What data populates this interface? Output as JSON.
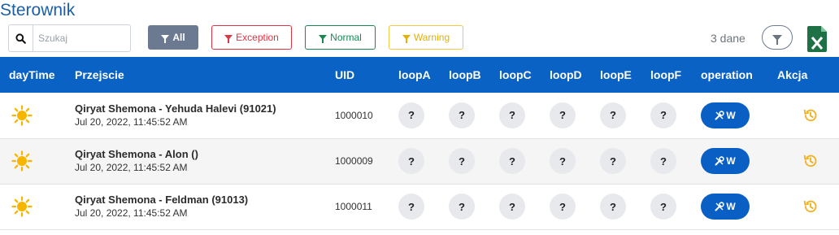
{
  "page": {
    "title": "Sterownik"
  },
  "search": {
    "placeholder": "Szukaj",
    "value": ""
  },
  "filters": {
    "all": "All",
    "exception": "Exception",
    "normal": "Normal",
    "warning": "Warning"
  },
  "count": "3 dane",
  "colors": {
    "header_bg": "#0a63c4",
    "accent": "#0a5fc4",
    "exception": "#dc3545",
    "normal": "#198754",
    "warning": "#e5b000",
    "sun": "#f7b500"
  },
  "table": {
    "headers": [
      "dayTime",
      "Przejscie",
      "UID",
      "loopA",
      "loopB",
      "loopC",
      "loopD",
      "loopE",
      "loopF",
      "operation",
      "Akcja"
    ],
    "rows": [
      {
        "daytime_icon": "sun-icon",
        "name": "Qiryat Shemona - Yehuda Halevi (91021)",
        "date": "Jul 20, 2022, 11:45:52 AM",
        "uid": "1000010",
        "loops": [
          "?",
          "?",
          "?",
          "?",
          "?",
          "?"
        ],
        "operation": "W",
        "action_icon": "history-icon"
      },
      {
        "daytime_icon": "sun-icon",
        "name": "Qiryat Shemona - Alon ()",
        "date": "Jul 20, 2022, 11:45:52 AM",
        "uid": "1000009",
        "loops": [
          "?",
          "?",
          "?",
          "?",
          "?",
          "?"
        ],
        "operation": "W",
        "action_icon": "history-icon"
      },
      {
        "daytime_icon": "sun-icon",
        "name": "Qiryat Shemona - Feldman (91013)",
        "date": "Jul 20, 2022, 11:45:52 AM",
        "uid": "1000011",
        "loops": [
          "?",
          "?",
          "?",
          "?",
          "?",
          "?"
        ],
        "operation": "W",
        "action_icon": "history-icon"
      }
    ]
  },
  "icons": {
    "search": "search-icon",
    "filter": "filter-icon",
    "excel": "excel-export-icon",
    "tools": "tools-icon"
  }
}
